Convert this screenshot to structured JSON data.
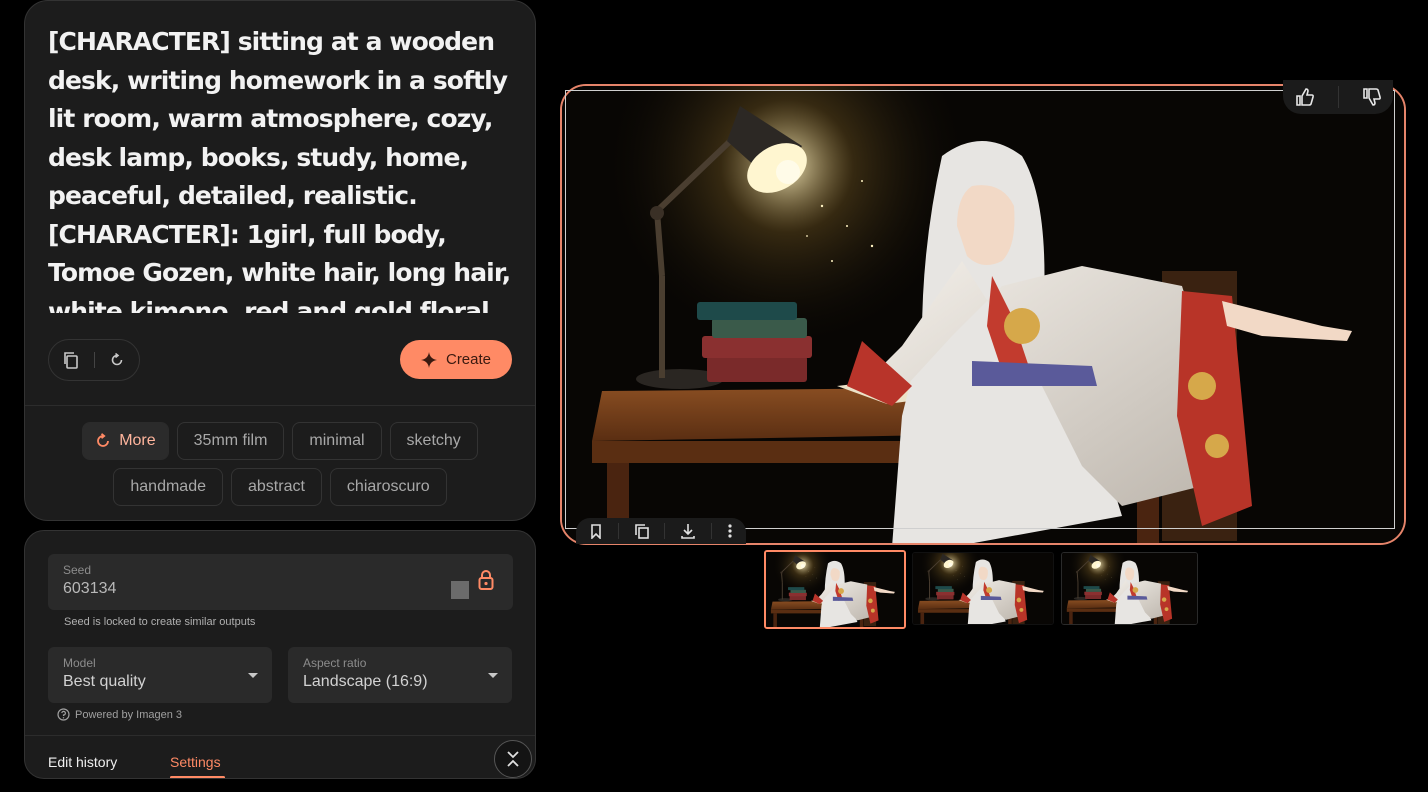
{
  "prompt": {
    "text": "[CHARACTER] sitting at a wooden desk, writing homework in a softly lit room, warm atmosphere, cozy, desk lamp, books, study, home, peaceful, detailed, realistic. [CHARACTER]: 1girl, full body, Tomoe Gozen, white hair, long hair, white kimono, red and gold floral pattern, standing, arms"
  },
  "toolbar": {
    "copy_icon": "copy-icon",
    "reset_icon": "refresh-icon",
    "create_label": "Create",
    "create_icon": "sparkle-icon"
  },
  "style_chips": {
    "more_label": "More",
    "row1": [
      "35mm film",
      "minimal",
      "sketchy"
    ],
    "row2": [
      "handmade",
      "abstract",
      "chiaroscuro"
    ]
  },
  "settings": {
    "seed_label": "Seed",
    "seed_value": "603134",
    "seed_helper": "Seed is locked to create similar outputs",
    "model_label": "Model",
    "model_value": "Best quality",
    "aspect_label": "Aspect ratio",
    "aspect_value": "Landscape (16:9)",
    "powered_by": "Powered by Imagen 3"
  },
  "tabs": {
    "edit_history": "Edit history",
    "settings": "Settings",
    "active": "Settings"
  },
  "image_actions": [
    "bookmark-icon",
    "copy-icon",
    "download-icon",
    "more-vert-icon"
  ],
  "rating": [
    "thumb-up-icon",
    "thumb-down-icon"
  ],
  "thumbnails": {
    "count": 3,
    "selected": 1
  },
  "colors": {
    "accent": "#ff8a65",
    "card_bg": "#1c1c1c",
    "page_bg": "#000000"
  }
}
